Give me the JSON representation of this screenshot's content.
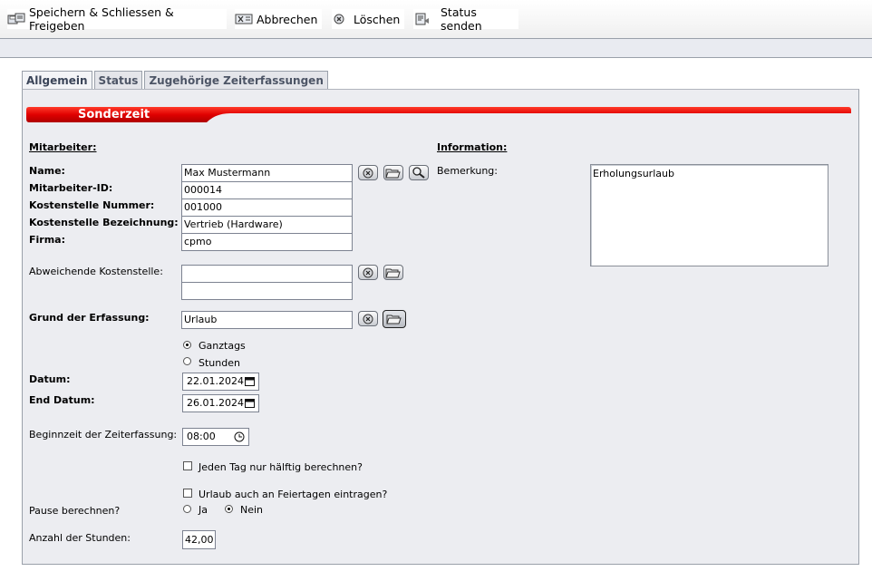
{
  "toolbar": {
    "save_label": "Speichern & Schliessen & Freigeben",
    "cancel_label": "Abbrechen",
    "delete_label": "Löschen",
    "send_status_label": "Status senden"
  },
  "tabs": [
    "Allgemein",
    "Status",
    "Zugehörige Zeiterfassungen"
  ],
  "section_title": "Sonderzeit",
  "colors": {
    "accent_red": "#e00000",
    "panel_bg": "#ecedf1"
  },
  "employee": {
    "heading": "Mitarbeiter:",
    "name_label": "Name:",
    "name_value": "Max Mustermann",
    "id_label": "Mitarbeiter-ID:",
    "id_value": "000014",
    "cc_number_label": "Kostenstelle Nummer:",
    "cc_number_value": "001000",
    "cc_name_label": "Kostenstelle Bezeichnung:",
    "cc_name_value": "Vertrieb (Hardware)",
    "company_label": "Firma:",
    "company_value": "cpmo"
  },
  "alt_cost_center": {
    "label": "Abweichende Kostenstelle:",
    "value1": "",
    "value2": ""
  },
  "reason": {
    "label": "Grund der Erfassung:",
    "value": "Urlaub"
  },
  "duration": {
    "fullday_label": "Ganztags",
    "hours_label": "Stunden",
    "selected": "Ganztags"
  },
  "date": {
    "label": "Datum:",
    "value": "22.01.2024"
  },
  "end_date": {
    "label": "End Datum:",
    "value": "26.01.2024"
  },
  "start_time": {
    "label": "Beginnzeit der Zeiterfassung:",
    "value": "08:00"
  },
  "half_day": {
    "label": "Jeden Tag nur hälftig berechnen?",
    "checked": false
  },
  "holidays": {
    "label": "Urlaub auch an Feiertagen eintragen?",
    "checked": false
  },
  "pause": {
    "label": "Pause berechnen?",
    "yes_label": "Ja",
    "no_label": "Nein",
    "selected": "Nein"
  },
  "hours": {
    "label": "Anzahl der Stunden:",
    "value": "42,00"
  },
  "information": {
    "heading": "Information:",
    "remark_label": "Bemerkung:",
    "remark_value": "Erholungsurlaub"
  },
  "icons": [
    "save-close-release-icon",
    "cancel-icon",
    "delete-icon",
    "send-status-icon",
    "clear-icon",
    "folder-icon",
    "search-icon",
    "calendar-icon",
    "clock-icon"
  ]
}
